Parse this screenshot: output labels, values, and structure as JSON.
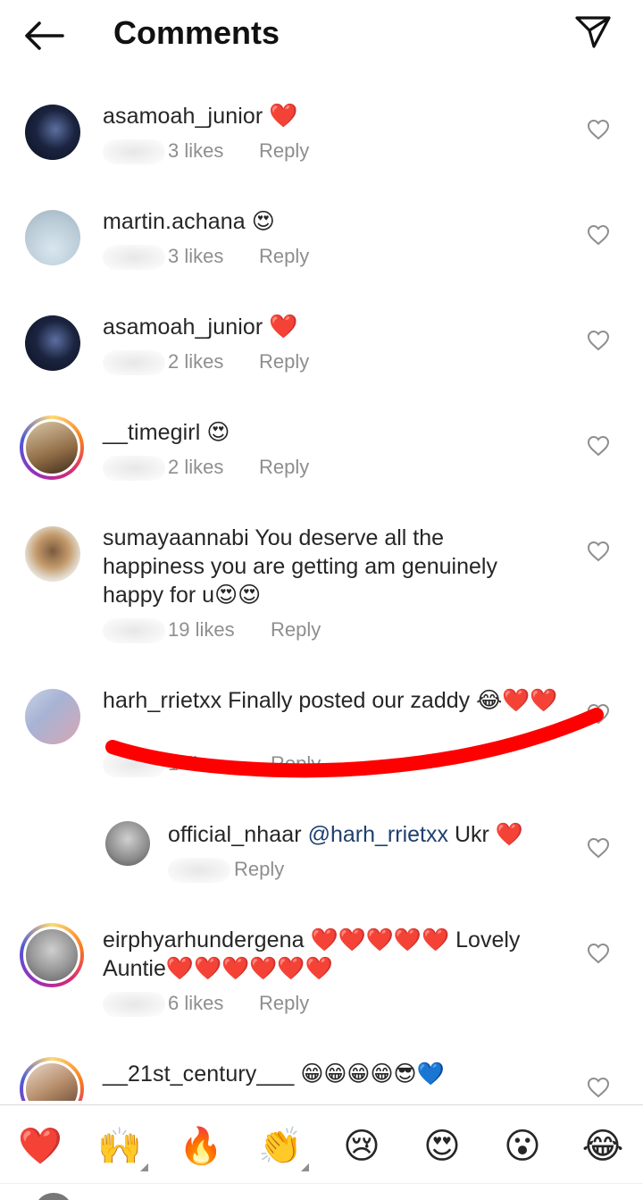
{
  "header": {
    "title": "Comments"
  },
  "comments": [
    {
      "user": "asamoah_junior",
      "text": "❤️",
      "time": "2d",
      "likes": "3 likes",
      "reply": "Reply"
    },
    {
      "user": "martin.achana",
      "text": "😍",
      "time": "2d",
      "likes": "3 likes",
      "reply": "Reply"
    },
    {
      "user": "asamoah_junior",
      "text": "❤️",
      "time": "2d",
      "likes": "2 likes",
      "reply": "Reply"
    },
    {
      "user": "__timegirl",
      "text": "😍",
      "time": "2d",
      "likes": "2 likes",
      "reply": "Reply"
    },
    {
      "user": "sumayaannabi",
      "text": "You deserve all the happiness you are getting am genuinely happy for u😍😍",
      "time": "2d",
      "likes": "19 likes",
      "reply": "Reply"
    },
    {
      "user": "harh_rrietxx",
      "text": "Finally posted our zaddy 😂❤️❤️",
      "time": "2d",
      "likes": "1 like",
      "reply": "Reply"
    },
    {
      "user": "official_nhaar",
      "mention": "@harh_rrietxx",
      "text": "Ukr ❤️",
      "time": "1h",
      "likes": "",
      "reply": "Reply"
    },
    {
      "user": "eirphyarhundergena",
      "text": "❤️❤️❤️❤️❤️ Lovely Auntie❤️❤️❤️❤️❤️❤️",
      "time": "23h",
      "likes": "6 likes",
      "reply": "Reply"
    },
    {
      "user": "__21st_century___",
      "text": "😁😁😁😁😎💙",
      "time": "",
      "likes": "",
      "reply": ""
    }
  ],
  "reactions": [
    "❤️",
    "🙌",
    "🔥",
    "👏",
    "😢",
    "😍",
    "😮",
    "😂"
  ],
  "colors": {
    "accent_red": "#ed1b24",
    "muted": "#8e8e8e",
    "mention": "#1f3f6e"
  }
}
